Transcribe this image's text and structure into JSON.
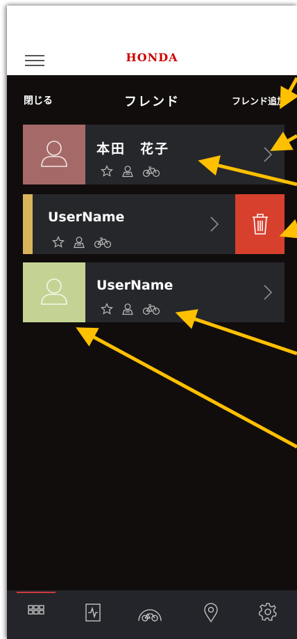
{
  "app": {
    "brand_logo": "HONDA"
  },
  "header": {
    "close_label": "閉じる",
    "title": "フレンド",
    "add_label": "フレンド追加"
  },
  "friends": [
    {
      "name": "本田　花子",
      "avatar_color": "#a56a68",
      "icons": [
        "star-icon",
        "rider-icon",
        "bicycle-icon"
      ]
    },
    {
      "name": "UserName",
      "strip_color": "#d9b45a",
      "icons": [
        "star-icon",
        "rider-icon",
        "bicycle-icon"
      ],
      "swiped_delete": true
    },
    {
      "name": "UserName",
      "avatar_color": "#c4d394",
      "icons": [
        "star-icon",
        "rider-icon",
        "bicycle-icon"
      ]
    }
  ],
  "bottom_nav": {
    "items": [
      "dashboard-icon",
      "report-icon",
      "speedometer-bike-icon",
      "location-pin-icon",
      "settings-gear-icon"
    ],
    "active_index": 0
  },
  "colors": {
    "background": "#120d0d",
    "card": "#26272b",
    "delete": "#d8402e",
    "brand": "#cc0000",
    "annotation_arrow": "#ffc000"
  }
}
